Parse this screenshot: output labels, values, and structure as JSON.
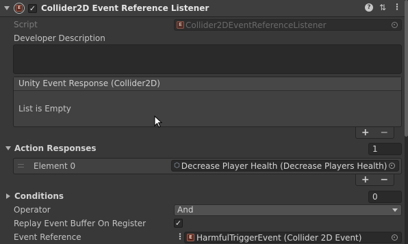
{
  "component": {
    "title": "Collider2D Event Reference Listener",
    "enabled": true,
    "icon_letters": "⁝E",
    "header_icons": [
      "help-icon",
      "presets-icon",
      "more-icon"
    ]
  },
  "script_field": {
    "label": "Script",
    "value": "Collider2DEventReferenceListener"
  },
  "developer_description": {
    "label": "Developer Description",
    "value": ""
  },
  "unity_event": {
    "header": "Unity Event Response (Collider2D)",
    "empty_text": "List is Empty",
    "add_label": "+",
    "remove_label": "−"
  },
  "action_responses": {
    "label": "Action Responses",
    "count": "1",
    "elements": [
      {
        "label": "Element 0",
        "value": "Decrease Player Health (Decrease Players Health)"
      }
    ],
    "add_label": "+",
    "remove_label": "−"
  },
  "conditions": {
    "label": "Conditions",
    "count": "0"
  },
  "operator": {
    "label": "Operator",
    "value": "And"
  },
  "replay_buffer": {
    "label": "Replay Event Buffer On Register",
    "checked": true
  },
  "event_reference": {
    "label": "Event Reference",
    "value": "HarmfulTriggerEvent (Collider 2D Event)"
  },
  "colors": {
    "background": "#383838",
    "field": "#2a2a2a",
    "header": "#3e3e3e",
    "text": "#c4c4c4"
  }
}
